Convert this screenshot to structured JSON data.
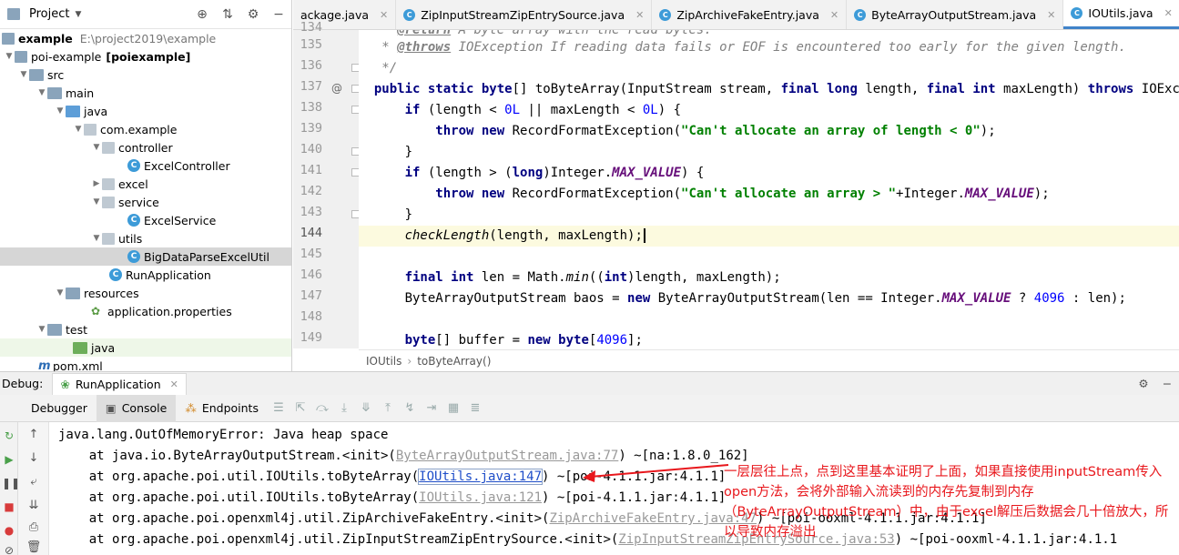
{
  "project_panel": {
    "title": "Project",
    "tree": [
      {
        "label": "example",
        "path": "E:\\project2019\\example"
      },
      {
        "label": "poi-example",
        "module": "[poiexample]"
      },
      {
        "label": "src"
      },
      {
        "label": "main"
      },
      {
        "label": "java"
      },
      {
        "label": "com.example"
      },
      {
        "label": "controller"
      },
      {
        "label": "ExcelController"
      },
      {
        "label": "excel"
      },
      {
        "label": "service"
      },
      {
        "label": "ExcelService"
      },
      {
        "label": "utils"
      },
      {
        "label": "BigDataParseExcelUtil"
      },
      {
        "label": "RunApplication"
      },
      {
        "label": "resources"
      },
      {
        "label": "application.properties"
      },
      {
        "label": "test"
      },
      {
        "label": "java"
      },
      {
        "label": "pom.xml"
      }
    ]
  },
  "editor": {
    "tabs": [
      {
        "label": "ackage.java"
      },
      {
        "label": "ZipInputStreamZipEntrySource.java"
      },
      {
        "label": "ZipArchiveFakeEntry.java"
      },
      {
        "label": "ByteArrayOutputStream.java"
      },
      {
        "label": "IOUtils.java"
      }
    ],
    "line_numbers": [
      "134",
      "135",
      "136",
      "137",
      "138",
      "139",
      "140",
      "141",
      "142",
      "143",
      "144",
      "145",
      "146",
      "147",
      "148",
      "149"
    ],
    "current_line": "144",
    "breadcrumb": [
      "IOUtils",
      "toByteArray()"
    ]
  },
  "debug": {
    "label": "Debug:",
    "run_config": "RunApplication",
    "tabs": {
      "debugger": "Debugger",
      "console": "Console",
      "endpoints": "Endpoints"
    },
    "console_lines": [
      "java.lang.OutOfMemoryError: Java heap space",
      "    at java.io.ByteArrayOutputStream.<init>(",
      "    at org.apache.poi.util.IOUtils.toByteArray(",
      "    at org.apache.poi.util.IOUtils.toByteArray(",
      "    at org.apache.poi.openxml4j.util.ZipArchiveFakeEntry.<init>(",
      "    at org.apache.poi.openxml4j.util.ZipInputStreamZipEntrySource.<init>("
    ],
    "console_links": [
      "ByteArrayOutputStream.java:77",
      "IOUtils.java:147",
      "IOUtils.java:121",
      "ZipArchiveFakeEntry.java:47",
      "ZipInputStreamZipEntrySource.java:53"
    ],
    "console_suffixes": [
      ") ~[na:1.8.0_162]",
      ") ~[poi-4.1.1.jar:4.1.1]",
      ") ~[poi-4.1.1.jar:4.1.1]",
      ") ~[poi-ooxml-4.1.1.jar:4.1.1]",
      ") ~[poi-ooxml-4.1.1.jar:4.1.1"
    ]
  },
  "annotation": {
    "text": "一层层往上点，点到这里基本证明了上面，如果直接使用inputStream传入open方法，会将外部输入流读到的内存先复制到内存（ByteArrayOutputStream）中，由于excel解压后数据会几十倍放大，所以导致内存溢出",
    "color": "#e8171c"
  }
}
